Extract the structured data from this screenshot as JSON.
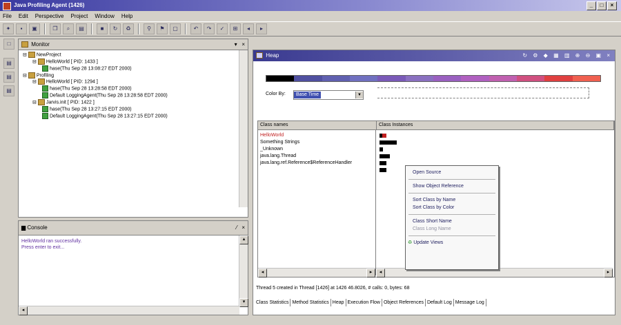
{
  "window": {
    "title": "Java Profiling Agent (1426)",
    "controls": [
      "_",
      "□",
      "×"
    ]
  },
  "menu": [
    "File",
    "Edit",
    "Perspective",
    "Project",
    "Window",
    "Help"
  ],
  "toolbar_icons": [
    "new-icon",
    "save-icon",
    "print-icon",
    "copy-icon",
    "search-icon",
    "monitor-icon",
    "stop-icon",
    "refresh-icon",
    "gc-icon",
    "pin-icon",
    "filter-icon",
    "open-icon",
    "undo-icon",
    "redo-icon",
    "check-icon",
    "attach-icon",
    "back-icon",
    "forward-icon"
  ],
  "monitor": {
    "title": "Monitor",
    "tree": [
      {
        "text": "NewProject",
        "level": 0,
        "icon": "folder"
      },
      {
        "text": "HelloWorld [ PID: 1433 ]",
        "level": 1,
        "icon": "process"
      },
      {
        "text": "hase(Thu Sep 28 13:08:27 EDT 2000)",
        "level": 2,
        "icon": "agent"
      },
      {
        "text": "Profiling",
        "level": 0,
        "icon": "folder"
      },
      {
        "text": "HelloWorld [ PID: 1294 ]",
        "level": 1,
        "icon": "process"
      },
      {
        "text": "hase(Thu Sep 28 13:28:58 EDT 2000)",
        "level": 2,
        "icon": "agent"
      },
      {
        "text": "Default LoggingAgent(Thu Sep 28 13:28:58 EDT 2000)",
        "level": 2,
        "icon": "agent"
      },
      {
        "text": "Jarvis.init [ PID: 1422 ]",
        "level": 1,
        "icon": "process"
      },
      {
        "text": "hase(Thu Sep 28 13:27:15 EDT 2000)",
        "level": 2,
        "icon": "agent"
      },
      {
        "text": "Default LoggingAgent(Thu Sep 28 13:27:15 EDT 2000)",
        "level": 2,
        "icon": "agent"
      }
    ]
  },
  "console": {
    "title": "Console",
    "lines": [
      "HelloWorld ran successfully.",
      "Press enter to exit..."
    ]
  },
  "heap": {
    "title": "Heap",
    "color_by_label": "Color By:",
    "color_by_value": "Base Time",
    "color_scale": [
      "#000000",
      "#5050a0",
      "#6060b0",
      "#7070c0",
      "#7a5ab8",
      "#8a70c0",
      "#9a60c0",
      "#b060c0",
      "#c060b0",
      "#d05080",
      "#e04040",
      "#f06050"
    ],
    "columns": [
      "Class names",
      "Class Instances"
    ],
    "classes": [
      {
        "name": "HelloWorld",
        "color": "#c02020",
        "instances": 2
      },
      {
        "name": "Something Strings",
        "color": "#000000",
        "instances": 5
      },
      {
        "name": "_Unknown",
        "color": "#000000",
        "instances": 1
      },
      {
        "name": "java.lang.Thread",
        "color": "#000000",
        "instances": 3
      },
      {
        "name": "java.lang.ref.Reference$ReferenceHandler",
        "color": "#000000",
        "instances": 2
      },
      {
        "name": "",
        "color": "#000000",
        "instances": 2
      }
    ],
    "status": "Thread 5 created in Thread [1426] at 1426 46.8026, # calls: 0, bytes: 68",
    "tabs": [
      "Class Statistics",
      "Method Statistics",
      "Heap",
      "Execution Flow",
      "Object References",
      "Default Log",
      "Message Log"
    ]
  },
  "context_menu": {
    "items": [
      {
        "label": "Open Source",
        "enabled": true,
        "group": 0
      },
      {
        "label": "Show Object Reference",
        "enabled": true,
        "group": 1
      },
      {
        "label": "Sort Class by Name",
        "enabled": true,
        "group": 2
      },
      {
        "label": "Sort Class by Color",
        "enabled": true,
        "group": 2
      },
      {
        "label": "Class Short Name",
        "enabled": true,
        "group": 3
      },
      {
        "label": "Class Long Name",
        "enabled": false,
        "group": 3
      },
      {
        "label": "Update Views",
        "enabled": true,
        "group": 4
      }
    ]
  }
}
